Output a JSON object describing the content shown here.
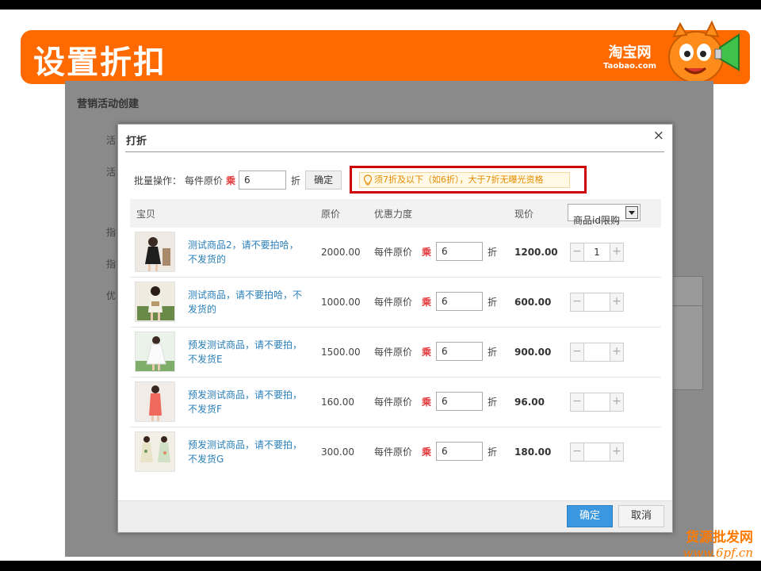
{
  "slide": {
    "title": "设置折扣",
    "brand_cn": "淘宝网",
    "brand_en": "Taobao.com",
    "watermark_line1": "货源批发网",
    "watermark_line2": "www.6pf.cn"
  },
  "page": {
    "title": "营销活动创建",
    "side_labels": [
      "活",
      "活",
      "指",
      "指",
      "优"
    ]
  },
  "dialog": {
    "title": "打折",
    "close_glyph": "×",
    "batch": {
      "label": "批量操作：",
      "per_item": "每件原价",
      "multiply": "乘",
      "value": "6",
      "unit": "折",
      "confirm": "确定"
    },
    "notice": "须7折及以下（如6折），大于7折无曝光资格",
    "columns": {
      "item": "宝贝",
      "price": "原价",
      "discount": "优惠力度",
      "now": "现价",
      "limit_select": "商品id限购"
    },
    "rows": [
      {
        "name": "测试商品2，请不要拍哈，不发货的",
        "price": "2000.00",
        "per_item": "每件原价",
        "multiply": "乘",
        "discount": "6",
        "unit": "折",
        "now": "1200.00",
        "qty": "1"
      },
      {
        "name": "测试商品，请不要拍哈，不发货的",
        "price": "1000.00",
        "per_item": "每件原价",
        "multiply": "乘",
        "discount": "6",
        "unit": "折",
        "now": "600.00",
        "qty": ""
      },
      {
        "name": "预发测试商品，请不要拍，不发货E",
        "price": "1500.00",
        "per_item": "每件原价",
        "multiply": "乘",
        "discount": "6",
        "unit": "折",
        "now": "900.00",
        "qty": ""
      },
      {
        "name": "预发测试商品，请不要拍，不发货F",
        "price": "160.00",
        "per_item": "每件原价",
        "multiply": "乘",
        "discount": "6",
        "unit": "折",
        "now": "96.00",
        "qty": ""
      },
      {
        "name": "预发测试商品，请不要拍，不发货G",
        "price": "300.00",
        "per_item": "每件原价",
        "multiply": "乘",
        "discount": "6",
        "unit": "折",
        "now": "180.00",
        "qty": ""
      }
    ],
    "stepper_minus": "−",
    "stepper_plus": "+",
    "ok": "确定",
    "cancel": "取消"
  },
  "colors": {
    "brand_orange": "#ff6a00",
    "link_blue": "#2a7fb8",
    "ok_blue": "#3b98e0",
    "highlight_red": "#cc0000"
  }
}
